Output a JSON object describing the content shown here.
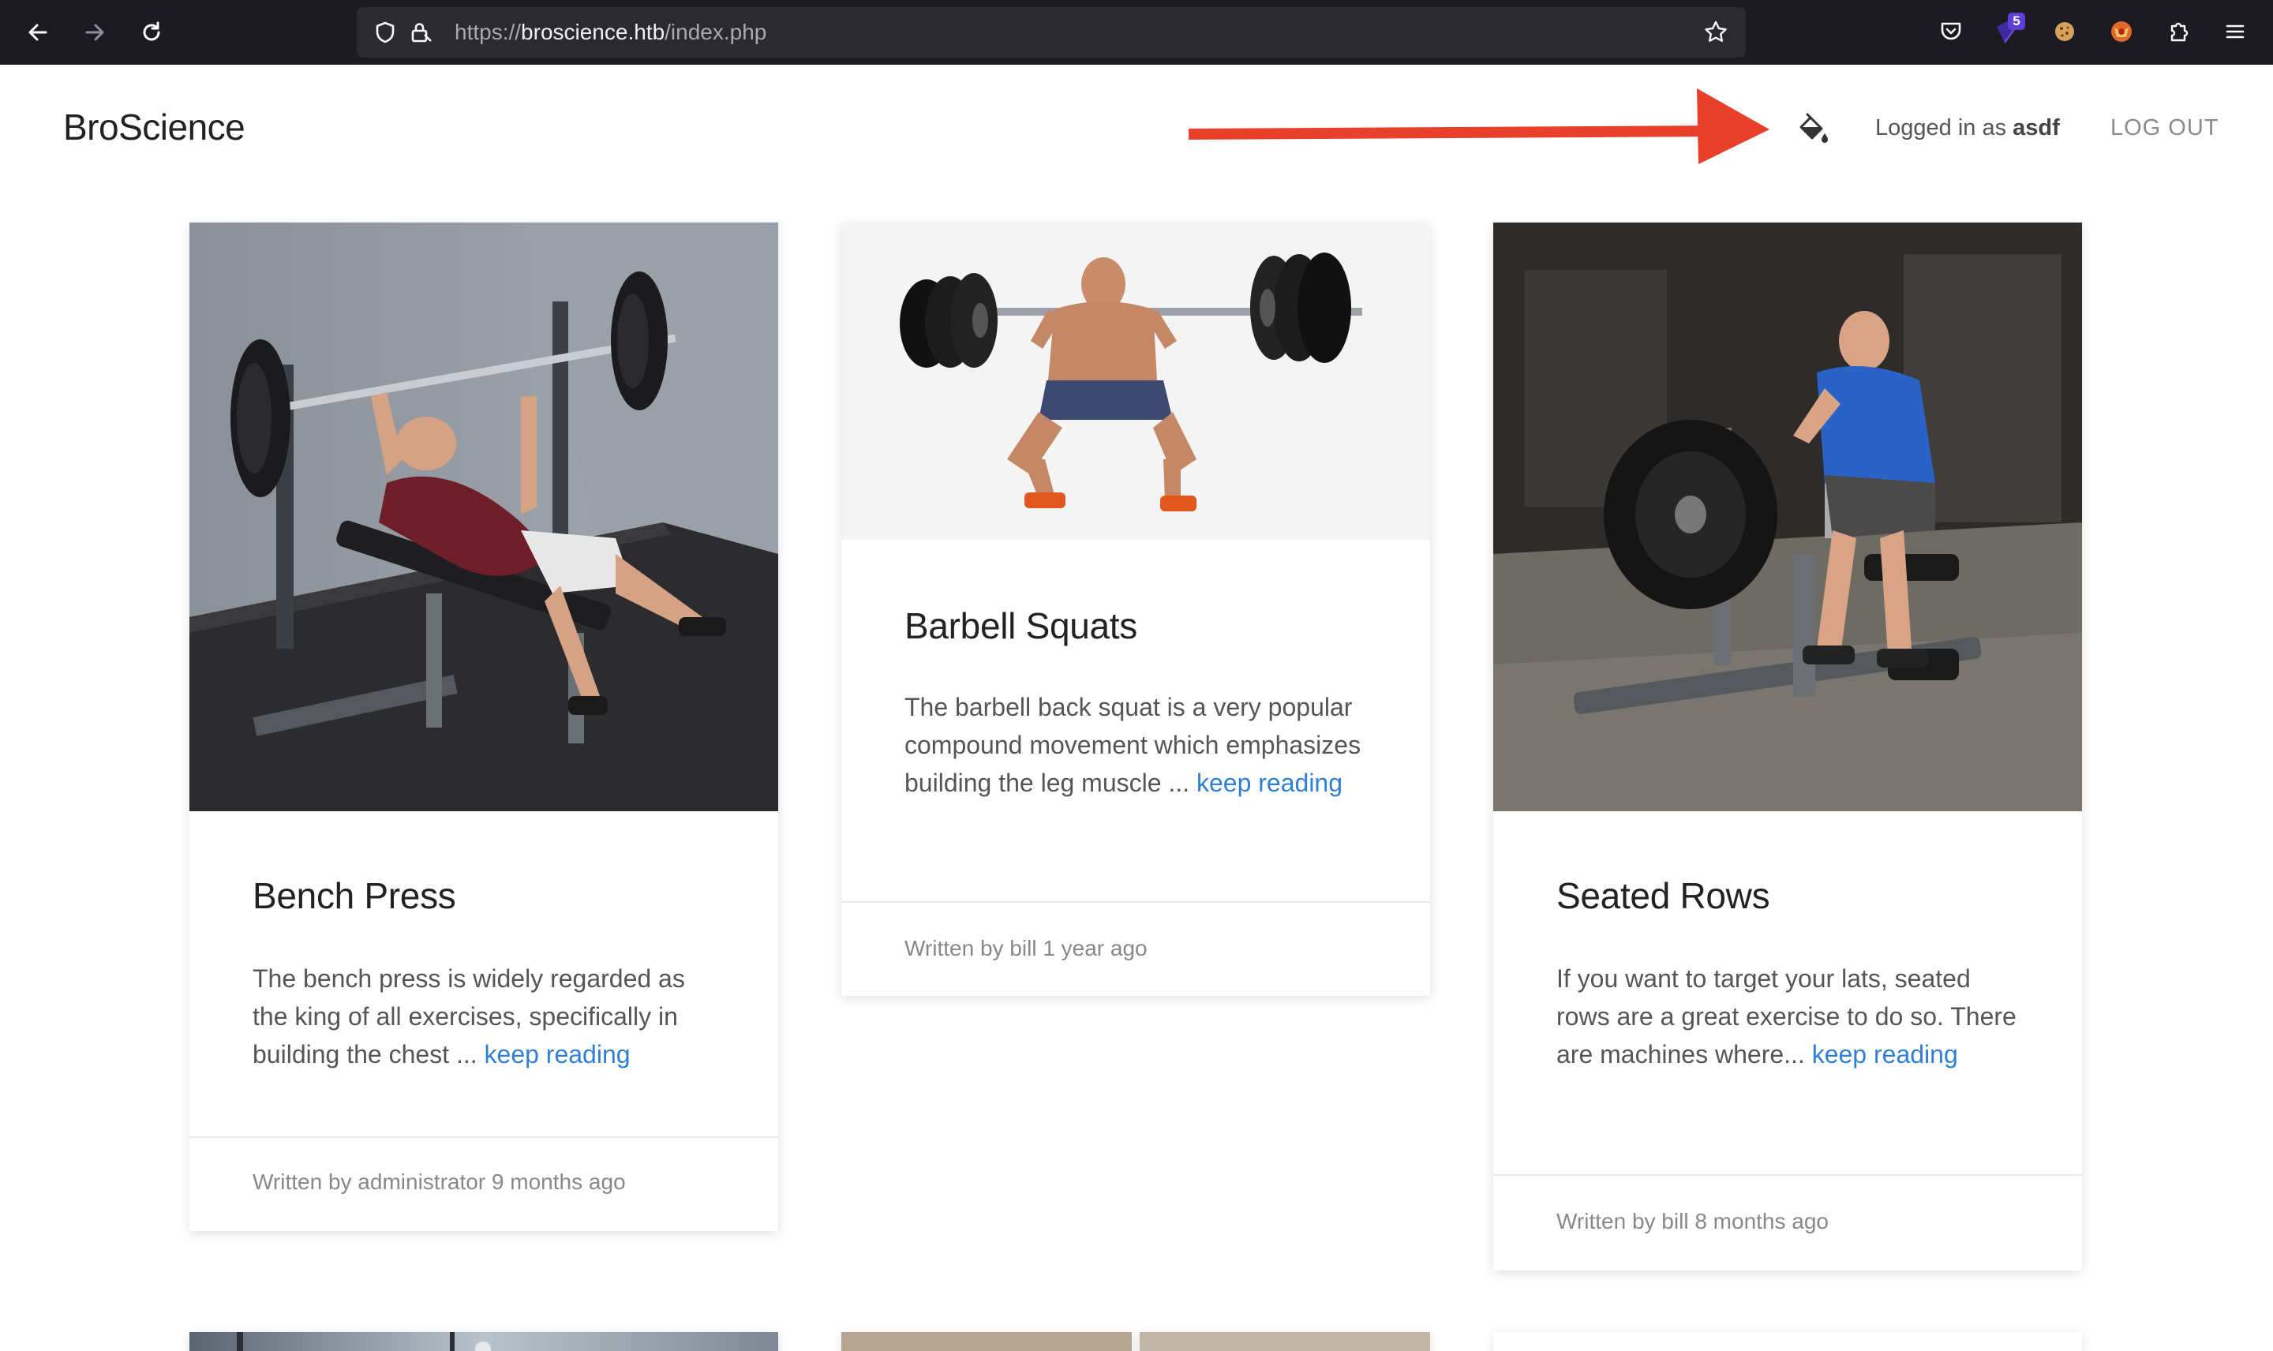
{
  "browser": {
    "url_prefix": "https://",
    "url_host": "broscience.htb",
    "url_path": "/index.php",
    "extension_badge": "5"
  },
  "site": {
    "brand": "BroScience",
    "logged_in_prefix": "Logged in as ",
    "username": "asdf",
    "logout_label": "LOG OUT",
    "accent_color": "#2f7fd6",
    "annotation_arrow_color": "#e8402a"
  },
  "posts": [
    {
      "title": "Bench Press",
      "excerpt": "The bench press is widely regarded as the king of all exercises, specifically in building the chest ... ",
      "more": "keep reading",
      "meta": "Written by administrator 9 months ago"
    },
    {
      "title": "Barbell Squats",
      "excerpt": "The barbell back squat is a very popular compound movement which emphasizes building the leg muscle ... ",
      "more": "keep reading",
      "meta": "Written by bill 1 year ago"
    },
    {
      "title": "Seated Rows",
      "excerpt": "If you want to target your lats, seated rows are a great exercise to do so. There are machines where... ",
      "more": "keep reading",
      "meta": "Written by bill 8 months ago"
    }
  ]
}
